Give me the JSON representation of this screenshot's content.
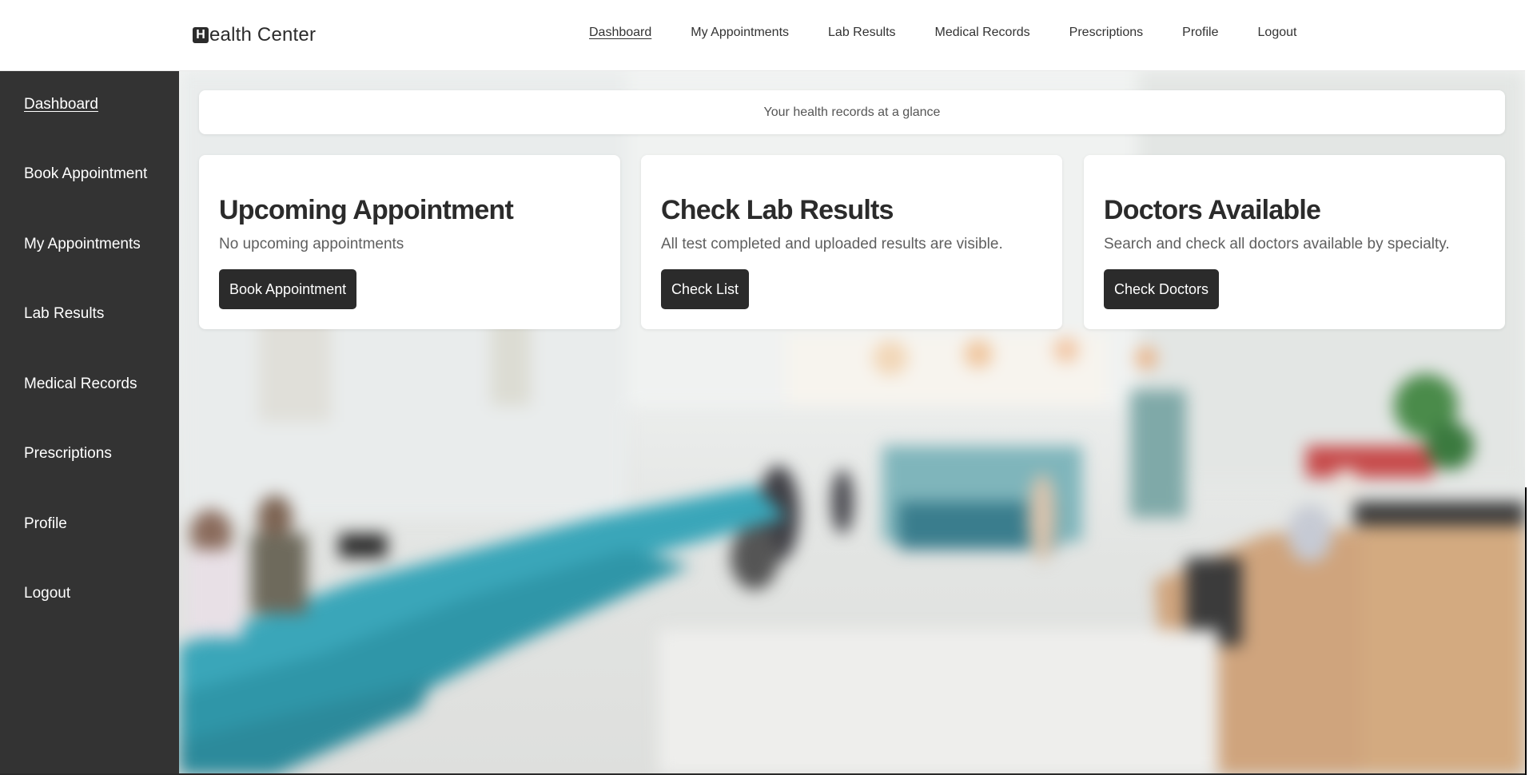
{
  "header": {
    "logo_mark": "H",
    "logo_text": "ealth Center",
    "nav": [
      {
        "label": "Dashboard",
        "active": true
      },
      {
        "label": "My Appointments"
      },
      {
        "label": "Lab Results"
      },
      {
        "label": "Medical Records"
      },
      {
        "label": "Prescriptions"
      },
      {
        "label": "Profile"
      },
      {
        "label": "Logout"
      }
    ]
  },
  "sidebar": {
    "items": [
      {
        "label": "Dashboard",
        "active": true
      },
      {
        "label": "Book Appointment"
      },
      {
        "label": "My Appointments"
      },
      {
        "label": "Lab Results"
      },
      {
        "label": "Medical Records"
      },
      {
        "label": "Prescriptions"
      },
      {
        "label": "Profile"
      },
      {
        "label": "Logout"
      }
    ]
  },
  "main": {
    "banner_text": "Your health records at a glance",
    "cards": [
      {
        "title": "Upcoming Appointment",
        "description": "No upcoming appointments",
        "button_label": "Book Appointment"
      },
      {
        "title": "Check Lab Results",
        "description": "All test completed and uploaded results are visible.",
        "button_label": "Check List"
      },
      {
        "title": "Doctors Available",
        "description": "Search and check all doctors available by specialty.",
        "button_label": "Check Doctors"
      }
    ]
  },
  "colors": {
    "sidebar_bg": "#333333",
    "button_bg": "#2b2b2b",
    "accent_teal": "#3aa6b9"
  }
}
